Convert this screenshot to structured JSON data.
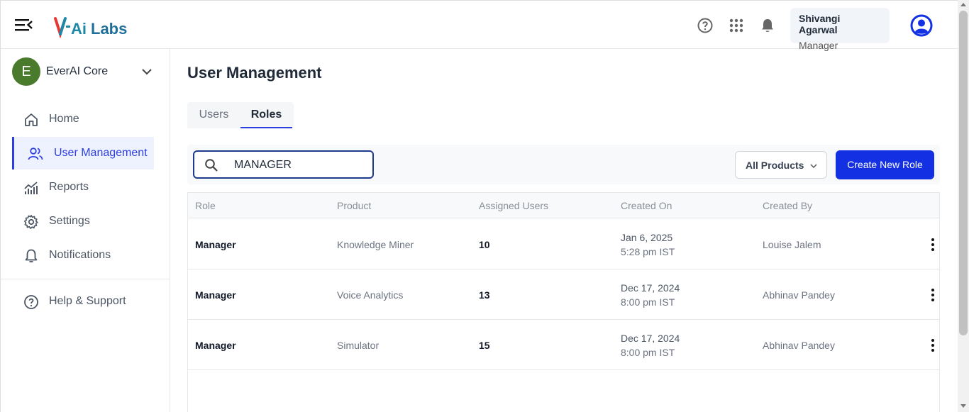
{
  "header": {
    "logo_text": "V-AiLabs",
    "user_name": "Shivangi Agarwal",
    "user_role": "Manager",
    "icons": [
      "menu-collapse-icon",
      "help-icon",
      "apps-grid-icon",
      "bell-icon",
      "account-circle-icon"
    ]
  },
  "sidebar": {
    "org": {
      "initial": "E",
      "name": "EverAI Core"
    },
    "items": [
      {
        "label": "Home",
        "icon": "home-icon"
      },
      {
        "label": "User Management",
        "icon": "users-icon",
        "active": true
      },
      {
        "label": "Reports",
        "icon": "chart-icon"
      },
      {
        "label": "Settings",
        "icon": "gear-icon"
      },
      {
        "label": "Notifications",
        "icon": "bell-icon"
      },
      {
        "label": "Help & Support",
        "icon": "help-icon"
      }
    ]
  },
  "main": {
    "title": "User Management",
    "tabs": [
      {
        "label": "Users"
      },
      {
        "label": "Roles",
        "active": true
      }
    ],
    "search": {
      "value": "MANAGER"
    },
    "product_filter": {
      "selected": "All Products"
    },
    "create_button": "Create New Role",
    "table": {
      "headers": [
        "Role",
        "Product",
        "Assigned Users",
        "Created On",
        "Created By"
      ],
      "rows": [
        {
          "role": "Manager",
          "product": "Knowledge Miner",
          "assigned": "10",
          "date": "Jan 6, 2025",
          "time": "5:28 pm IST",
          "created_by": "Louise Jalem"
        },
        {
          "role": "Manager",
          "product": "Voice Analytics",
          "assigned": "13",
          "date": "Dec 17, 2024",
          "time": "8:00 pm IST",
          "created_by": "Abhinav Pandey"
        },
        {
          "role": "Manager",
          "product": "Simulator",
          "assigned": "15",
          "date": "Dec 17, 2024",
          "time": "8:00 pm IST",
          "created_by": "Abhinav Pandey"
        }
      ]
    }
  },
  "colors": {
    "accent": "#1330e3",
    "active_nav": "#2d3fe0",
    "org_avatar": "#4a7a2c"
  }
}
